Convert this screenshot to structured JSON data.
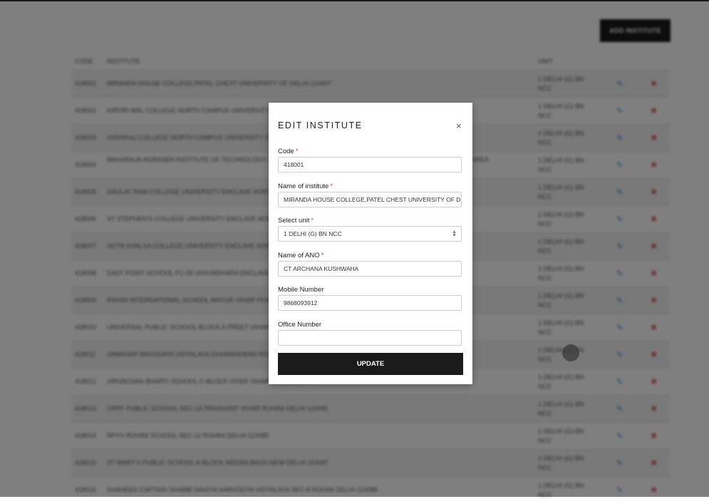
{
  "page": {
    "add_button": "ADD INSTITUTE",
    "headers": {
      "code": "CODE",
      "institute": "INSTITUTE",
      "unit": "UNIT"
    },
    "rows": [
      {
        "code": "418001",
        "institute": "MIRANDA HOUSE COLLEGE,PATEL CHEST UNIVERSITY OF DELHI-110007",
        "unit": "1 DELHI (G) BN NCC"
      },
      {
        "code": "418002",
        "institute": "KIRORI MAL COLLEGE NORTH CAMPUS UNIVERSITY OF DELHI-110007",
        "unit": "1 DELHI (G) BN NCC"
      },
      {
        "code": "418003",
        "institute": "HANSRAJ COLLEGE NORTH CAMPUS UNIVERSITY OF DELHI-110007",
        "unit": "1 DELHI (G) BN NCC"
      },
      {
        "code": "418004",
        "institute": "MAHARAJA AGRASEN INSTITUTE OF TECHNOLOGY SECTOR-22 ROHINI NEAR RITHALA METRO POLICE STATION PSP AREA",
        "unit": "1 DELHI (G) BN NCC",
        "two_line": true
      },
      {
        "code": "418005",
        "institute": "DAULAT RAM COLLEGE UNIVERSITY ENCLAVE NORTH CAMPUS DELHI-110007",
        "unit": "1 DELHI (G) BN NCC"
      },
      {
        "code": "418006",
        "institute": "ST STEPHEN'S COLLEGE UNIVERSITY ENCLAVE NORTH CAMPUS DELHI-110007",
        "unit": "1 DELHI (G) BN NCC"
      },
      {
        "code": "418007",
        "institute": "SGTB KHALSA COLLEGE UNIVERSITY ENCLAVE NORTH CAMPUS DELHI-110007",
        "unit": "1 DELHI (G) BN NCC"
      },
      {
        "code": "418008",
        "institute": "EAST POINT SCHOOL FC-26 VASUNDHARA ENCLAVE DELHI-110096",
        "unit": "1 DELHI (G) BN NCC"
      },
      {
        "code": "418009",
        "institute": "RAYAN INTERNATIONAL SCHOOL MAYUR VIHAR PHASE-III DELHI-110096",
        "unit": "1 DELHI (G) BN NCC"
      },
      {
        "code": "418010",
        "institute": "UNIVERSAL PUBLIC SCHOOL BLOCK A PREET VIHAR DELHI-110092",
        "unit": "1 DELHI (G) BN NCC"
      },
      {
        "code": "418011",
        "institute": "JAWAHAR NAVODAYA VIDYALAYA GHUMANHERA ROAD NAJAFGARH DELHI",
        "unit": "1 DELHI (G) BN NCC"
      },
      {
        "code": "418012",
        "institute": "VIRVACHAN BHARTI SCHOOL C-BLOCK VIVEK VIHAR DELHI-110095",
        "unit": "1 DELHI (G) BN NCC"
      },
      {
        "code": "418013",
        "institute": "CRPF PUBLIC SCHOOL SEC-14 PRASHANT VIHAR ROHINI DELHI-110085",
        "unit": "1 DELHI (G) BN NCC"
      },
      {
        "code": "418014",
        "institute": "RPVV ROHINI SCHOOL SEC-11 ROHINI DELHI-110085",
        "unit": "1 DELHI (G) BN NCC"
      },
      {
        "code": "418015",
        "institute": "ST MARY'S PUBLIC SCHOOL A-BLOCK MEERA BAGH NEW DELHI-110087",
        "unit": "1 DELHI (G) BN NCC"
      },
      {
        "code": "418016",
        "institute": "SHAHEED CAPTAIN SHABBI DAHIYA SARVODYA VIDYALAYA SEC-8 ROHINI DELHI-110085",
        "unit": "1 DELHI (G) BN NCC"
      }
    ]
  },
  "modal": {
    "title": "EDIT INSTITUTE",
    "close": "×",
    "code_label": "Code",
    "code_value": "418001",
    "institute_label": "Name of institute",
    "institute_value": "MIRANDA HOUSE COLLEGE,PATEL CHEST UNIVERSITY OF DELHI-110007",
    "unit_label": "Select unit",
    "unit_value": "1 DELHI (G) BN NCC",
    "ano_label": "Name of ANO",
    "ano_value": "CT ARCHANA KUSHWAHA",
    "mobile_label": "Mobile Number",
    "mobile_value": "9868093912",
    "office_label": "Office Number",
    "office_value": "",
    "update_label": "UPDATE",
    "required_mark": "*"
  }
}
